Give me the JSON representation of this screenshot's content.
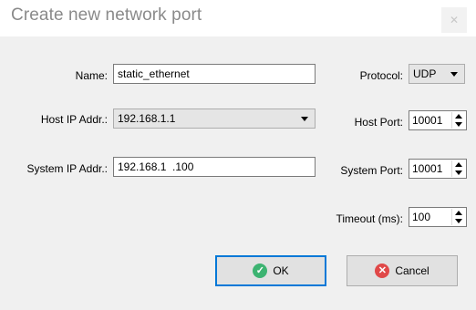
{
  "window": {
    "title": "Create new network port",
    "close_glyph": "✕"
  },
  "form": {
    "name_label": "Name:",
    "name_value": "static_ethernet",
    "host_ip_label": "Host IP Addr.:",
    "host_ip_value": "192.168.1.1",
    "system_ip_label": "System IP Addr.:",
    "system_ip_value": "192.168.1  .100",
    "protocol_label": "Protocol:",
    "protocol_value": "UDP",
    "host_port_label": "Host Port:",
    "host_port_value": "10001",
    "system_port_label": "System Port:",
    "system_port_value": "10001",
    "timeout_label": "Timeout (ms):",
    "timeout_value": "100"
  },
  "buttons": {
    "ok_label": "OK",
    "ok_icon": "check-circle-icon",
    "ok_icon_glyph": "✓",
    "cancel_label": "Cancel",
    "cancel_icon": "x-circle-icon",
    "cancel_icon_glyph": "✕"
  },
  "colors": {
    "ok_icon": "#3cb371",
    "cancel_icon": "#e04848",
    "default_button_border": "#0078d7"
  }
}
